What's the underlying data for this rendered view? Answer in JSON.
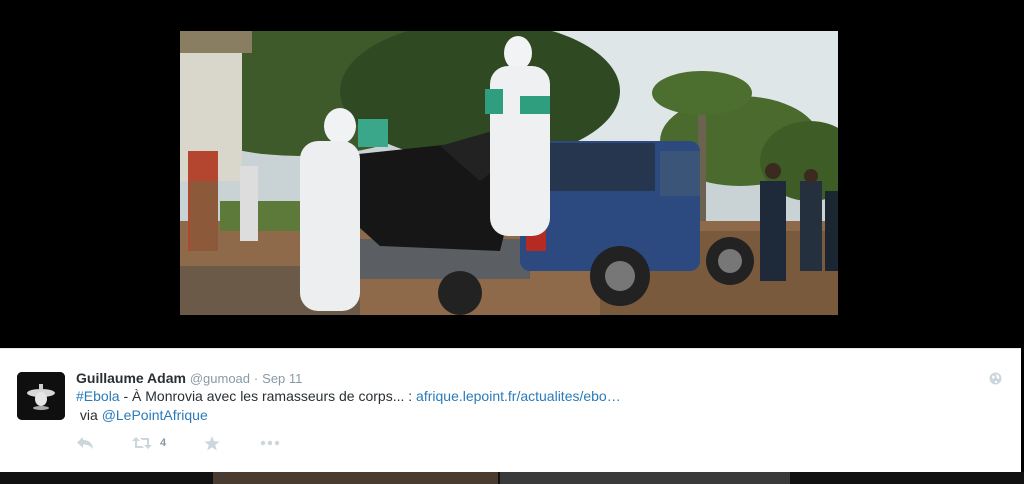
{
  "tweet": {
    "fullname": "Guillaume Adam",
    "username": "@gumoad",
    "separator": "·",
    "timestamp": "Sep 11",
    "hashtag": "#Ebola",
    "text_middle": " - À Monrovia avec les ramasseurs de corps... : ",
    "url_text": "afrique.lepoint.fr/actualites/ebo…",
    "via_text": "via ",
    "via_mention": "@LePointAfrique",
    "retweet_count": "4"
  },
  "colors": {
    "link": "#2b7bb9",
    "action_icon": "#ccd6dd",
    "muted_text": "#8899a6",
    "media_background": "#000000"
  },
  "icons": {
    "avatar": "avatar-image",
    "globe": "globe-icon",
    "reply": "reply-icon",
    "retweet": "retweet-icon",
    "favorite": "star-icon",
    "more": "more-dots-icon"
  }
}
